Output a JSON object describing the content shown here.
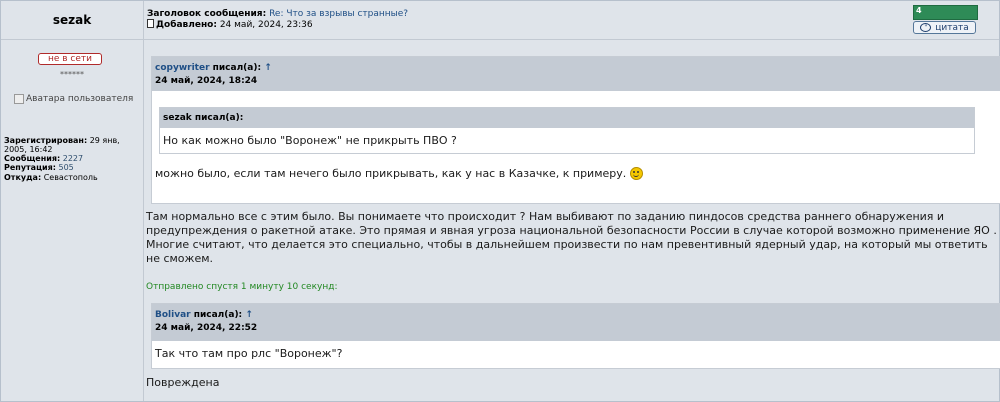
{
  "post": {
    "author": "sezak",
    "subject_label": "Заголовок сообщения:",
    "subject": "Re: Что за взрывы странные?",
    "added_label": "Добавлено:",
    "added": "24 май, 2024, 23:36",
    "rep_value": "4",
    "quote_button": "цитата"
  },
  "profile": {
    "status": "не в сети",
    "stars": "******",
    "avatar_alt": "Аватара пользователя",
    "registered_label": "Зарегистрирован:",
    "registered": "29 янв, 2005, 16:42",
    "messages_label": "Сообщения:",
    "messages": "2227",
    "reputation_label": "Репутация:",
    "reputation": "505",
    "from_label": "Откуда:",
    "from": "Севастополь"
  },
  "quote1": {
    "author": "copywriter",
    "wrote": "писал(а):",
    "arrow": "↑",
    "date": "24 май, 2024, 18:24",
    "inner_author": "sezak",
    "inner_wrote": "писал(а):",
    "inner_text": "Но как можно было \"Воронеж\" не прикрыть ПВО ?",
    "text": "можно было, если там нечего было прикрывать, как у нас в Казачке, к примеру."
  },
  "main_text": "Там нормально все с этим было. Вы понимаете что происходит ? Нам выбивают по заданию пиндосов средства раннего обнаружения и предупреждения о ракетной атаке. Это прямая и явная угроза национальной безопасности России в случае которой возможно применение ЯО . Многие считают, что делается это специально, чтобы в дальнейшем произвести по нам превентивный ядерный удар, на который мы ответить не сможем.",
  "sent_after": "Отправлено спустя 1 минуту 10 секунд:",
  "quote2": {
    "author": "Bolivar",
    "wrote": "писал(а):",
    "arrow": "↑",
    "date": "24 май, 2024, 22:52",
    "text": "Так что там про рлс \"Воронеж\"?"
  },
  "final_text": "Повреждена"
}
